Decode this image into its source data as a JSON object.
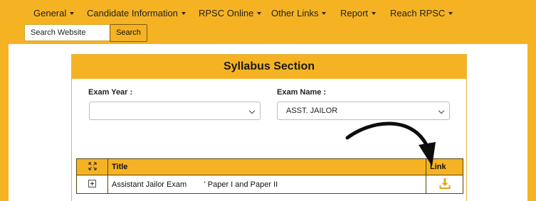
{
  "nav": {
    "items": [
      {
        "label": "General"
      },
      {
        "label": "Candidate Information"
      },
      {
        "label": "RPSC Online"
      },
      {
        "label": "Other Links"
      },
      {
        "label": "Report"
      },
      {
        "label": "Reach RPSC"
      }
    ]
  },
  "search": {
    "placeholder": "Search Website",
    "button_label": "Search"
  },
  "syllabus": {
    "title": "Syllabus Section",
    "exam_year_label": "Exam Year :",
    "exam_year_value": "",
    "exam_name_label": "Exam Name :",
    "exam_name_value": "ASST. JAILOR",
    "table": {
      "headers": {
        "title": "Title",
        "link": "Link"
      },
      "rows": [
        {
          "title": "Assistant Jailor Exam        ' Paper I and Paper II"
        }
      ]
    }
  },
  "colors": {
    "accent": "#f5b323",
    "download_icon": "#e8a317"
  },
  "icons": {
    "expand": "expand-arrows-icon",
    "row_toggle": "plus-box-icon",
    "download": "download-icon",
    "annotation": "curved-arrow"
  }
}
